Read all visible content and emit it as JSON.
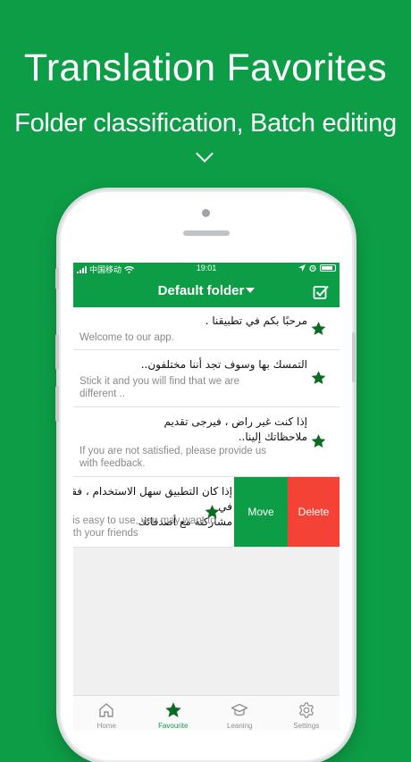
{
  "promo": {
    "headline": "Translation Favorites",
    "subline": "Folder classification, Batch editing"
  },
  "status_bar": {
    "carrier": "中国移动",
    "time": "19:01"
  },
  "nav": {
    "title": "Default folder"
  },
  "entries": [
    {
      "arabic": "مرحبًا بكم في تطبيقنا .",
      "english": "Welcome to our app."
    },
    {
      "arabic": "التمسك بها وسوف تجد أننا مختلفون..",
      "english": "Stick it and you will find that we are\ndifferent .."
    },
    {
      "arabic": "إذا كنت غير راض ، فيرجى تقديم\nملاحظاتك إلينا..",
      "english": "If you are not satisfied, please provide us\nwith feedback."
    },
    {
      "arabic": "إذا كان التطبيق سهل الاستخدام ، فقد ترغب في\nمشاركته مع أصدقائك",
      "english": "If the app is easy to use, you may want to\nshare it with your friends"
    }
  ],
  "swipe_actions": {
    "move": "Move",
    "delete": "Delete"
  },
  "tabs": [
    {
      "label": "Home",
      "icon": "home-icon"
    },
    {
      "label": "Favourite",
      "icon": "star-icon"
    },
    {
      "label": "Leaning",
      "icon": "graduation-cap-icon"
    },
    {
      "label": "Settings",
      "icon": "gear-icon"
    }
  ],
  "colors": {
    "brand_green": "#0d9d46",
    "delete_red": "#f44336",
    "star_green": "#0a6b22"
  }
}
